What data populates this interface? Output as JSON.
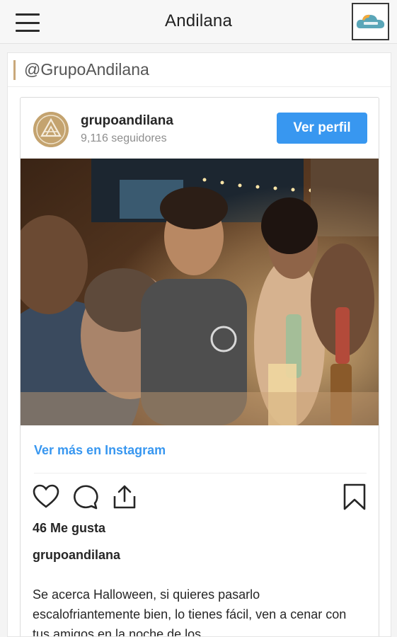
{
  "app": {
    "title": "Andilana",
    "menu_icon": "hamburger-menu-icon",
    "logo_icon": "whatscity-logo"
  },
  "page": {
    "handle": "@GrupoAndilana"
  },
  "instagram": {
    "username": "grupoandilana",
    "followers": "9,116 seguidores",
    "view_profile_label": "Ver perfil",
    "see_more_label": "Ver más en Instagram",
    "likes": "46 Me gusta",
    "caption_user": "grupoandilana",
    "caption": "Se acerca Halloween, si quieres pasarlo escalofriantemente bien, lo tienes fácil, ven a cenar con tus amigos en la noche de los",
    "colors": {
      "accent_blue": "#3897f0",
      "avatar_gold": "#c4a36f"
    },
    "icons": [
      "heart-icon",
      "comment-icon",
      "share-icon",
      "bookmark-icon"
    ]
  }
}
